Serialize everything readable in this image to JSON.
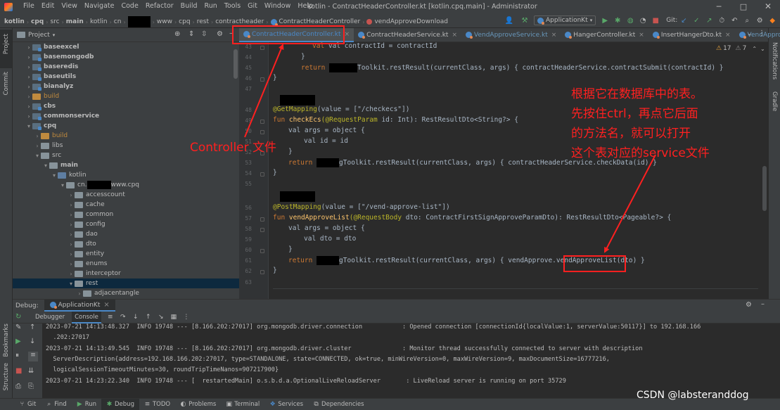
{
  "titlebar": {
    "menus": [
      "File",
      "Edit",
      "View",
      "Navigate",
      "Code",
      "Refactor",
      "Build",
      "Run",
      "Tools",
      "Git",
      "Window",
      "Help"
    ],
    "title": "kotlin - ContractHeaderController.kt [kotlin.cpq.main] - Administrator"
  },
  "navbar": {
    "crumbs": [
      "kotlin",
      "cpq",
      "src",
      "main",
      "kotlin",
      "cn",
      "",
      "www",
      "cpq",
      "rest",
      "contractheader"
    ],
    "crumb_class": "ContractHeaderController",
    "crumb_method": "vendApproveDownload",
    "run_config": "ApplicationKt",
    "git_label": "Git:"
  },
  "leftstrip": {
    "project": "Project",
    "commit": "Commit",
    "bookmarks": "Bookmarks",
    "structure": "Structure"
  },
  "rightstrip": {
    "notifications": "Notifications",
    "gradle": "Gradle"
  },
  "project": {
    "header": "Project",
    "tree": [
      {
        "label": "baseexcel",
        "bold": true,
        "indent": 1,
        "type": "mod",
        "open": false
      },
      {
        "label": "basemongodb",
        "bold": true,
        "indent": 1,
        "type": "mod",
        "open": false
      },
      {
        "label": "baseredis",
        "bold": true,
        "indent": 1,
        "type": "mod",
        "open": false
      },
      {
        "label": "baseutils",
        "bold": true,
        "indent": 1,
        "type": "mod",
        "open": false
      },
      {
        "label": "bianalyz",
        "bold": true,
        "indent": 1,
        "type": "mod",
        "open": false
      },
      {
        "label": "build",
        "bold": false,
        "indent": 1,
        "type": "orng",
        "open": false,
        "orange": true
      },
      {
        "label": "cbs",
        "bold": true,
        "indent": 1,
        "type": "mod",
        "open": false
      },
      {
        "label": "commonservice",
        "bold": true,
        "indent": 1,
        "type": "mod",
        "open": false
      },
      {
        "label": "cpq",
        "bold": true,
        "indent": 1,
        "type": "mod",
        "open": true
      },
      {
        "label": "build",
        "bold": false,
        "indent": 2,
        "type": "orng",
        "open": false,
        "orange": true
      },
      {
        "label": "libs",
        "bold": false,
        "indent": 2,
        "type": "plain",
        "open": false
      },
      {
        "label": "src",
        "bold": false,
        "indent": 2,
        "type": "plain",
        "open": true
      },
      {
        "label": "main",
        "bold": true,
        "indent": 3,
        "type": "plain",
        "open": true
      },
      {
        "label": "kotlin",
        "bold": false,
        "indent": 4,
        "type": "blue",
        "open": true
      },
      {
        "label": "cn.",
        "suffix": "www.cpq",
        "redact": true,
        "bold": false,
        "indent": 5,
        "type": "plain",
        "open": true
      },
      {
        "label": "accesscount",
        "bold": false,
        "indent": 6,
        "type": "plain",
        "open": false
      },
      {
        "label": "cache",
        "bold": false,
        "indent": 6,
        "type": "plain",
        "open": false
      },
      {
        "label": "common",
        "bold": false,
        "indent": 6,
        "type": "plain",
        "open": false
      },
      {
        "label": "config",
        "bold": false,
        "indent": 6,
        "type": "plain",
        "open": false
      },
      {
        "label": "dao",
        "bold": false,
        "indent": 6,
        "type": "plain",
        "open": false
      },
      {
        "label": "dto",
        "bold": false,
        "indent": 6,
        "type": "plain",
        "open": false
      },
      {
        "label": "entity",
        "bold": false,
        "indent": 6,
        "type": "plain",
        "open": false
      },
      {
        "label": "enums",
        "bold": false,
        "indent": 6,
        "type": "plain",
        "open": false
      },
      {
        "label": "interceptor",
        "bold": false,
        "indent": 6,
        "type": "plain",
        "open": false
      },
      {
        "label": "rest",
        "bold": false,
        "indent": 6,
        "type": "plain",
        "open": true,
        "selected": true
      },
      {
        "label": "adjacentangle",
        "bold": false,
        "indent": 7,
        "type": "plain",
        "open": false
      }
    ]
  },
  "editor": {
    "tabs": [
      "ContractHeaderController.kt",
      "ContractHeaderService.kt",
      "VendApproveService.kt",
      "HangerController.kt",
      "InsertHangerDto.kt",
      "VendApprov"
    ],
    "warnings": "17",
    "weak_warnings": "7",
    "line_numbers": [
      "43",
      "44",
      "45",
      "46",
      "47",
      "",
      "48",
      "49",
      "50",
      "51",
      "52",
      "53",
      "54",
      "55",
      "",
      "56",
      "57",
      "58",
      "59",
      "60",
      "61",
      "62",
      "63"
    ],
    "code": {
      "l43": "val contractId = contractId",
      "l44": "}",
      "l45_a": "return ",
      "l45_b": "Toolkit.restResult(currentClass, args) { contractHeaderService.contractSubmit(contractId) }",
      "l46": "}",
      "l48_ann": "@GetMapping",
      "l48_rest": "(value = [\"/checkecs\"])",
      "l49_fun": "fun ",
      "l49_name": "checkEcs",
      "l49_ann": "(@RequestParam ",
      "l49_rest": "id: Int): RestResultDto<String?> {",
      "l50": "val args = object {",
      "l51": "val id = id",
      "l52": "}",
      "l53_a": "return ",
      "l53_b": "gToolkit.restResult(currentClass, args) { contractHeaderService.checkData(id) }",
      "l54": "}",
      "l56_ann": "@PostMapping",
      "l56_rest": "(value = [\"/vend-approve-list\"])",
      "l57_fun": "fun ",
      "l57_name": "vendApproveList",
      "l57_ann": "(@RequestBody ",
      "l57_rest": "dto: ContractFirstSignApproveParamDto): RestResultDto<Pageable?> {",
      "l58": "val args = object {",
      "l59": "val dto = dto",
      "l60": "}",
      "l61_a": "return ",
      "l61_b": "gToolkit.restResult(currentClass, args) { vendApprove.",
      "l61_c": "vendApproveList",
      "l61_d": "(dto) }",
      "l62": "}"
    }
  },
  "annotations": {
    "controller_label": "Controller 文件",
    "service_note": [
      "根据它在数据库中的表。",
      "先按住ctrl，再点它后面",
      "的方法名，就可以打开",
      "这个表对应的service文件"
    ]
  },
  "debug": {
    "title": "Debug:",
    "config": "ApplicationKt",
    "tabs": [
      "Debugger",
      "Console"
    ],
    "lines": [
      "2023-07-21 14:13:48.327  INFO 19748 --- [8.166.202:27017] org.mongodb.driver.connection           : Opened connection [connectionId{localValue:1, serverValue:50117}] to 192.168.166",
      "  .202:27017",
      "2023-07-21 14:13:49.545  INFO 19748 --- [8.166.202:27017] org.mongodb.driver.cluster              : Monitor thread successfully connected to server with description",
      "  ServerDescription{address=192.168.166.202:27017, type=STANDALONE, state=CONNECTED, ok=true, minWireVersion=0, maxWireVersion=9, maxDocumentSize=16777216,",
      "  logicalSessionTimeoutMinutes=30, roundTripTimeNanos=907217900}",
      "2023-07-21 14:23:22.340  INFO 19748 --- [  restartedMain] o.s.b.d.a.OptionalLiveReloadServer       : LiveReload server is running on port 35729"
    ]
  },
  "statusbar": {
    "items": [
      "Git",
      "Find",
      "Run",
      "Debug",
      "TODO",
      "Problems",
      "Terminal",
      "Services",
      "Dependencies"
    ],
    "watermark": "CSDN @labsteranddog"
  }
}
